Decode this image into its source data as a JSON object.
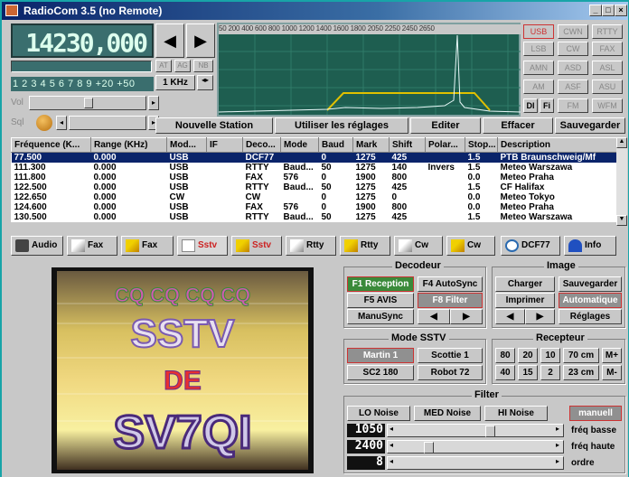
{
  "window": {
    "title": "RadioCom 3.5 (no Remote)"
  },
  "freq": {
    "display": "14230,000",
    "steps": "1 2 3 4 5 6 7 8 9 +20 +50",
    "step_select": "1 KHz",
    "agc": [
      "AT",
      "AG",
      "NB"
    ],
    "vol": "Vol",
    "sql": "Sql"
  },
  "spectrum": {
    "scale": "50 200 400 600 800 1000 1200 1400 1600 1800 2050 2250 2450 2650",
    "filter_level": 0.5
  },
  "modes": [
    [
      "USB",
      "CWN",
      "RTTY"
    ],
    [
      "LSB",
      "CW",
      "FAX"
    ],
    [
      "AMN",
      "ASD",
      "ASL"
    ],
    [
      "AM",
      "ASF",
      "ASU"
    ],
    [
      "DI",
      "Fi",
      "FM",
      "WFM"
    ]
  ],
  "station_buttons": [
    "Nouvelle Station",
    "Utiliser les réglages",
    "Editer",
    "Effacer",
    "Sauvegarder"
  ],
  "table": {
    "headers": [
      "Fréquence (K...",
      "Range (KHz)",
      "Mod...",
      "IF",
      "Deco...",
      "Mode",
      "Baud",
      "Mark",
      "Shift",
      "Polar...",
      "Stop...",
      "Description"
    ],
    "rows": [
      [
        "77.500",
        "0.000",
        "USB",
        "",
        "DCF77",
        "",
        "0",
        "1275",
        "425",
        "",
        "1.5",
        "PTB Braunschweig/Mf"
      ],
      [
        "111.300",
        "0.000",
        "USB",
        "",
        "RTTY",
        "Baud...",
        "50",
        "1275",
        "140",
        "Invers",
        "1.5",
        "Meteo Warszawa"
      ],
      [
        "111.800",
        "0.000",
        "USB",
        "",
        "FAX",
        "576",
        "0",
        "1900",
        "800",
        "",
        "0.0",
        "Meteo Praha"
      ],
      [
        "122.500",
        "0.000",
        "USB",
        "",
        "RTTY",
        "Baud...",
        "50",
        "1275",
        "425",
        "",
        "1.5",
        "CF Halifax"
      ],
      [
        "122.650",
        "0.000",
        "CW",
        "",
        "CW",
        "",
        "0",
        "1275",
        "0",
        "",
        "0.0",
        "Meteo Tokyo"
      ],
      [
        "124.600",
        "0.000",
        "USB",
        "",
        "FAX",
        "576",
        "0",
        "1900",
        "800",
        "",
        "0.0",
        "Meteo Praha"
      ],
      [
        "130.500",
        "0.000",
        "USB",
        "",
        "RTTY",
        "Baud...",
        "50",
        "1275",
        "425",
        "",
        "1.5",
        "Meteo Warszawa"
      ]
    ]
  },
  "tabs": [
    "Audio",
    "Fax",
    "Fax",
    "Sstv",
    "Sstv",
    "Rtty",
    "Rtty",
    "Cw",
    "Cw",
    "DCF77",
    "Info"
  ],
  "decodeur": {
    "title": "Decodeur",
    "f1": "F1 Reception",
    "f4": "F4 AutoSync",
    "f5": "F5 AVIS",
    "f8": "F8 Filter",
    "manusync": "ManuSync"
  },
  "image": {
    "title": "Image",
    "charger": "Charger",
    "sauvegarder": "Sauvegarder",
    "imprimer": "Imprimer",
    "automatique": "Automatique",
    "reglages": "Réglages"
  },
  "mode_sstv": {
    "title": "Mode SSTV",
    "b": [
      "Martin 1",
      "Scottie 1",
      "SC2 180",
      "Robot 72"
    ]
  },
  "recepteur": {
    "title": "Recepteur",
    "row1": [
      "80",
      "20",
      "10",
      "70 cm",
      "M+"
    ],
    "row2": [
      "40",
      "15",
      "2",
      "23 cm",
      "M-"
    ]
  },
  "filter": {
    "title": "Filter",
    "lo": "LO Noise",
    "med": "MED Noise",
    "hi": "HI Noise",
    "manuel": "manuell",
    "sliders": [
      {
        "value": "1050",
        "label": "fréq basse"
      },
      {
        "value": "2400",
        "label": "fréq haute"
      },
      {
        "value": "8",
        "label": "ordre"
      }
    ]
  },
  "image_text": {
    "cq": "CQ CQ CQ CQ",
    "sstv": "SSTV",
    "de": "DE",
    "call": "SV7QI"
  }
}
